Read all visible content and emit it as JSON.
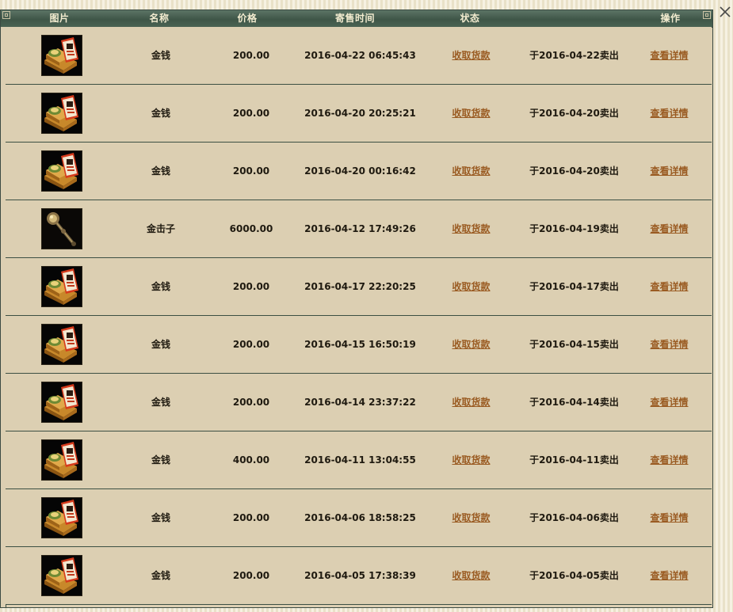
{
  "header": {
    "col_image": "图片",
    "col_name": "名称",
    "col_price": "价格",
    "col_time": "寄售时间",
    "col_status": "状态",
    "col_action": "操作"
  },
  "colors": {
    "panel_bg": "#dccfb2",
    "header_bg": "#3f5648",
    "header_text": "#f3ecd0",
    "link": "#9a5b22",
    "row_border": "#3c4f43"
  },
  "rows": [
    {
      "icon": "gold-coins-icon",
      "name": "金钱",
      "price": "200.00",
      "time": "2016-04-22 06:45:43",
      "status": "收取货款",
      "sold": "于2016-04-22卖出",
      "action": "查看详情"
    },
    {
      "icon": "gold-coins-icon",
      "name": "金钱",
      "price": "200.00",
      "time": "2016-04-20 20:25:21",
      "status": "收取货款",
      "sold": "于2016-04-20卖出",
      "action": "查看详情"
    },
    {
      "icon": "gold-coins-icon",
      "name": "金钱",
      "price": "200.00",
      "time": "2016-04-20 00:16:42",
      "status": "收取货款",
      "sold": "于2016-04-20卖出",
      "action": "查看详情"
    },
    {
      "icon": "mace-icon",
      "name": "金击子",
      "price": "6000.00",
      "time": "2016-04-12 17:49:26",
      "status": "收取货款",
      "sold": "于2016-04-19卖出",
      "action": "查看详情"
    },
    {
      "icon": "gold-coins-icon",
      "name": "金钱",
      "price": "200.00",
      "time": "2016-04-17 22:20:25",
      "status": "收取货款",
      "sold": "于2016-04-17卖出",
      "action": "查看详情"
    },
    {
      "icon": "gold-coins-icon",
      "name": "金钱",
      "price": "200.00",
      "time": "2016-04-15 16:50:19",
      "status": "收取货款",
      "sold": "于2016-04-15卖出",
      "action": "查看详情"
    },
    {
      "icon": "gold-coins-icon",
      "name": "金钱",
      "price": "200.00",
      "time": "2016-04-14 23:37:22",
      "status": "收取货款",
      "sold": "于2016-04-14卖出",
      "action": "查看详情"
    },
    {
      "icon": "gold-coins-icon",
      "name": "金钱",
      "price": "400.00",
      "time": "2016-04-11 13:04:55",
      "status": "收取货款",
      "sold": "于2016-04-11卖出",
      "action": "查看详情"
    },
    {
      "icon": "gold-coins-icon",
      "name": "金钱",
      "price": "200.00",
      "time": "2016-04-06 18:58:25",
      "status": "收取货款",
      "sold": "于2016-04-06卖出",
      "action": "查看详情"
    },
    {
      "icon": "gold-coins-icon",
      "name": "金钱",
      "price": "200.00",
      "time": "2016-04-05 17:38:39",
      "status": "收取货款",
      "sold": "于2016-04-05卖出",
      "action": "查看详情"
    }
  ],
  "close_icon": "close-icon"
}
